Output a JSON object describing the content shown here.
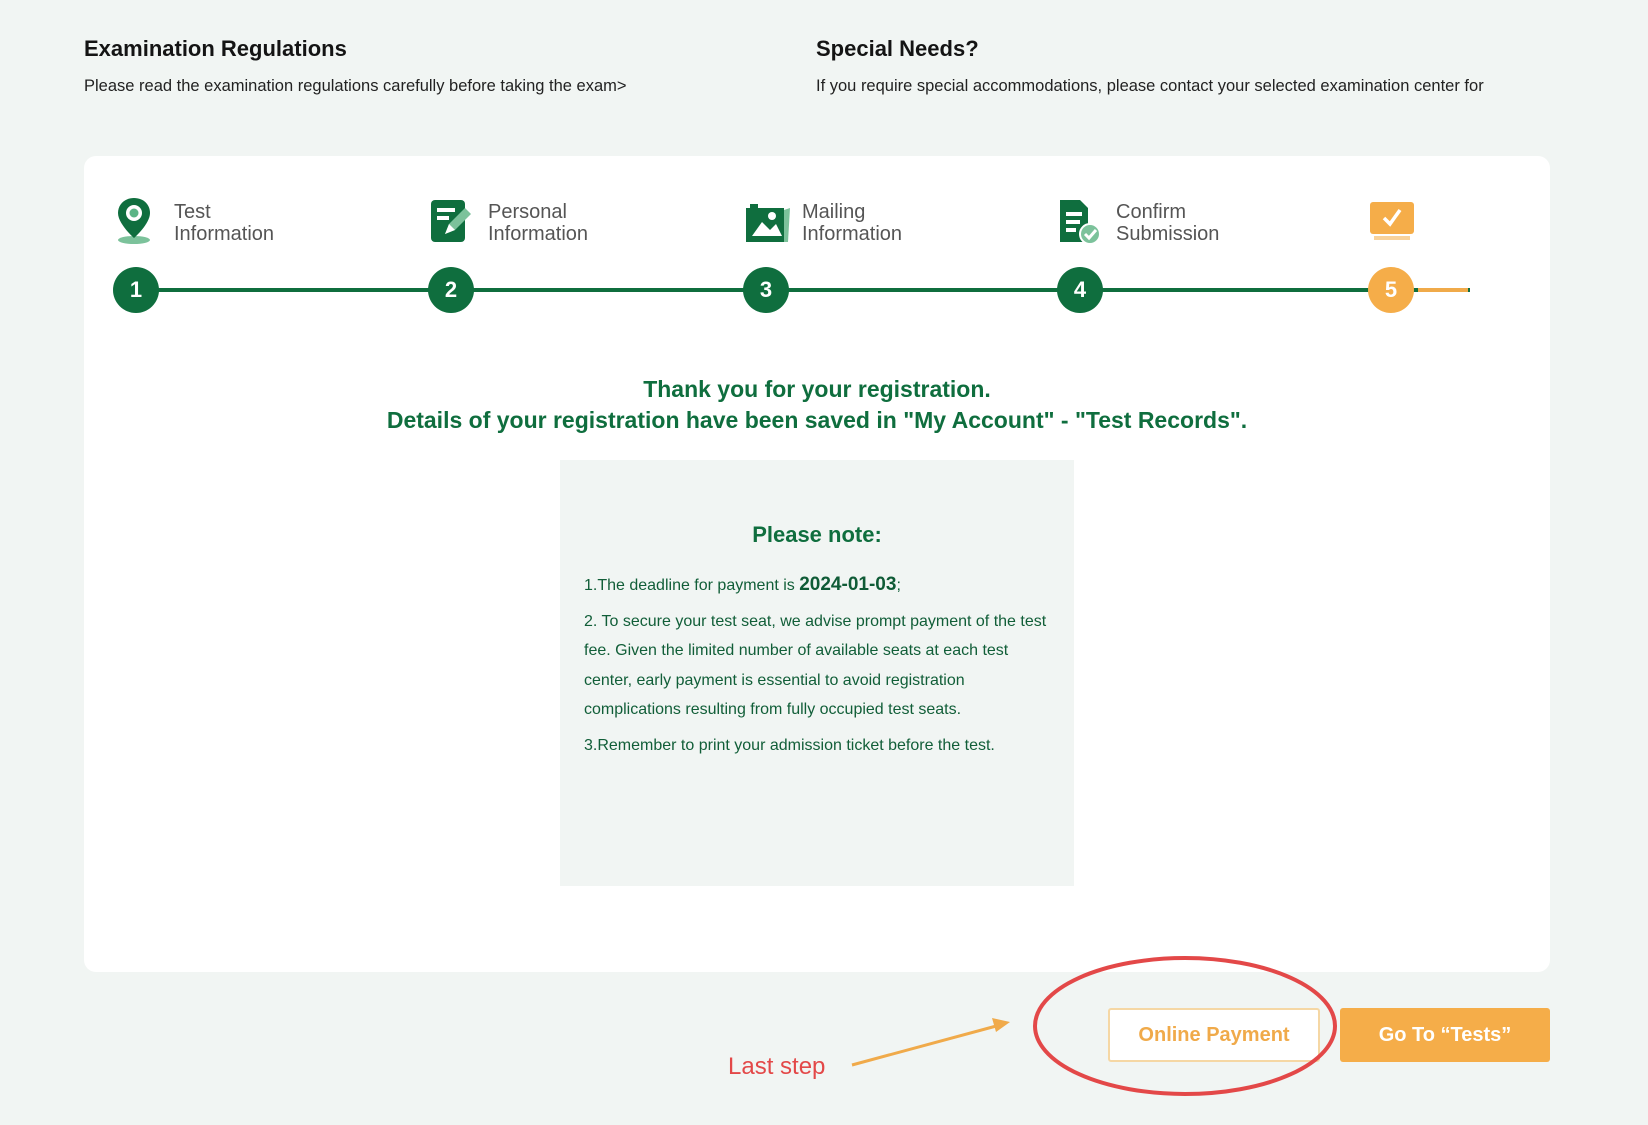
{
  "regulations": {
    "title": "Examination Regulations",
    "text": "Please read the examination regulations carefully before taking the exam>"
  },
  "special_needs": {
    "title": "Special Needs?",
    "text": "If you require special accommodations, please contact your selected examination center for"
  },
  "steps": [
    {
      "number": "1",
      "label_line1": "Test",
      "label_line2": "Information",
      "icon": "map-pin-icon"
    },
    {
      "number": "2",
      "label_line1": "Personal",
      "label_line2": "Information",
      "icon": "edit-form-icon"
    },
    {
      "number": "3",
      "label_line1": "Mailing",
      "label_line2": "Information",
      "icon": "photo-mail-icon"
    },
    {
      "number": "4",
      "label_line1": "Confirm",
      "label_line2": "Submission",
      "icon": "document-check-icon"
    },
    {
      "number": "5",
      "label_line1": "",
      "label_line2": "",
      "icon": "monitor-check-icon",
      "current": true
    }
  ],
  "confirmation": {
    "line1": "Thank you for your registration.",
    "line2": "Details of your registration have been saved in \"My Account\" - \"Test Records\"."
  },
  "note": {
    "title": "Please note:",
    "item1_prefix": "1.The deadline for payment is ",
    "deadline": "2024-01-03",
    "item1_suffix": ";",
    "item2": "2. To secure your test seat, we advise prompt payment of the test fee. Given the limited number of available seats at each test center, early payment is essential to avoid registration complications resulting from fully occupied test seats.",
    "item3": "3.Remember to print your admission ticket before the test."
  },
  "buttons": {
    "online_payment": "Online Payment",
    "go_to_tests": "Go To “Tests”"
  },
  "annotation": {
    "label": "Last step"
  },
  "colors": {
    "brand_green": "#0f6e3e",
    "accent_orange": "#f5ad49",
    "annotation_red": "#e34848"
  }
}
